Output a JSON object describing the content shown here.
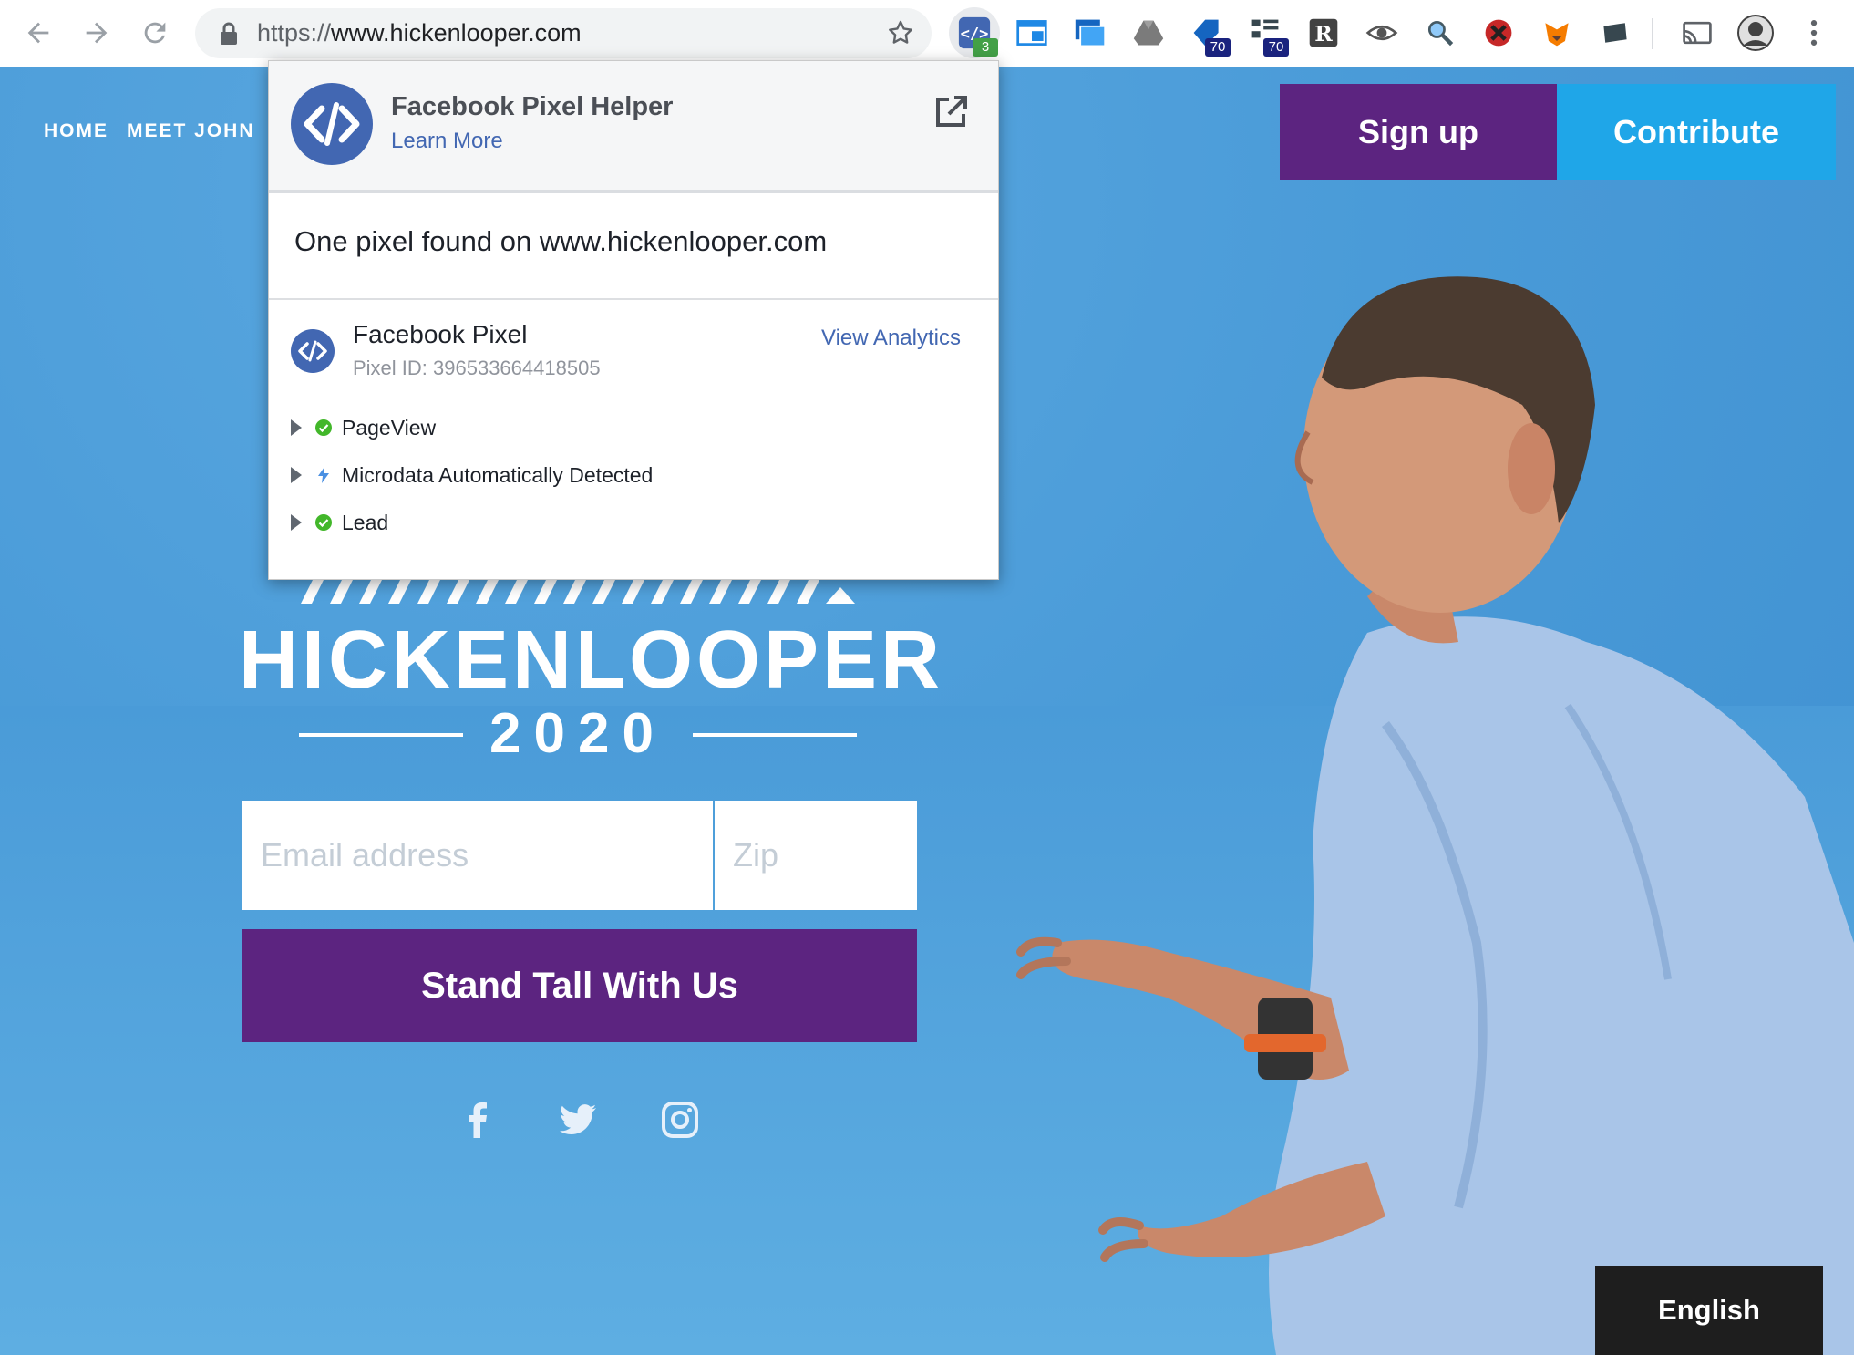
{
  "browser": {
    "url_scheme": "https://",
    "url_host": "www.hickenlooper.com",
    "extension_badges": {
      "pixel_helper": "3",
      "ext_a": "70",
      "ext_b": "70"
    },
    "icons": [
      "back-icon",
      "forward-icon",
      "reload-icon",
      "lock-icon",
      "star-icon",
      "pixel-helper-extension-icon",
      "cast-icon",
      "profile-avatar",
      "menu-icon"
    ]
  },
  "site": {
    "nav": [
      "HOME",
      "MEET JOHN"
    ],
    "signup_label": "Sign up",
    "contribute_label": "Contribute",
    "logo_name": "HICKENLOOPER",
    "logo_year": "2020",
    "email_placeholder": "Email address",
    "zip_placeholder": "Zip",
    "cta_label": "Stand Tall With Us",
    "social": [
      "facebook-icon",
      "twitter-icon",
      "instagram-icon"
    ],
    "language_label": "English",
    "colors": {
      "purple": "#5c2480",
      "blue": "#1fa6e8",
      "sky": "#4a9bd8"
    }
  },
  "popup": {
    "title": "Facebook Pixel Helper",
    "learn_more": "Learn More",
    "found_text": "One pixel found on www.hickenlooper.com",
    "pixel_name": "Facebook Pixel",
    "pixel_id": "Pixel ID: 396533664418505",
    "view_analytics": "View Analytics",
    "events": [
      {
        "label": "PageView",
        "status": "success"
      },
      {
        "label": "Microdata Automatically Detected",
        "status": "info"
      },
      {
        "label": "Lead",
        "status": "success"
      }
    ]
  }
}
